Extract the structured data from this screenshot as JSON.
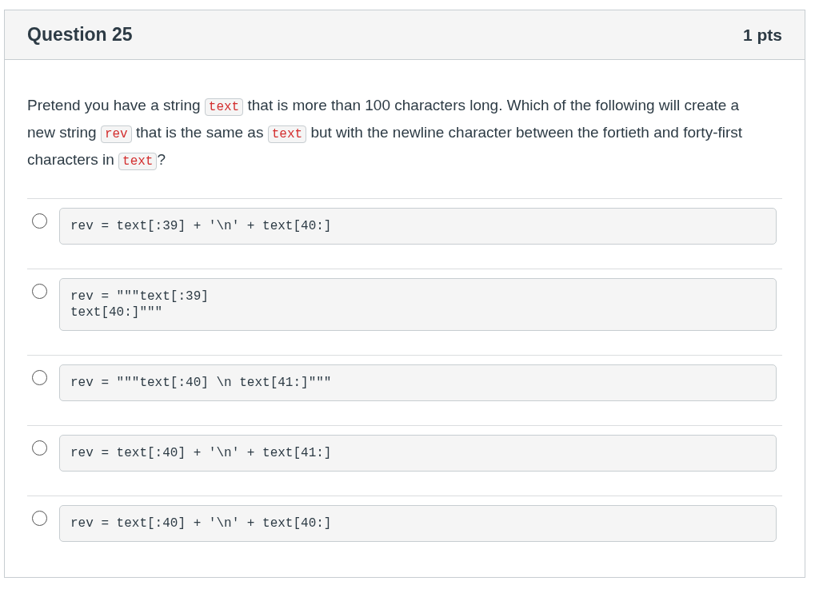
{
  "question": {
    "title": "Question 25",
    "points": "1 pts",
    "prompt": [
      {
        "kind": "text",
        "text": "Pretend you have a string "
      },
      {
        "kind": "code",
        "text": "text"
      },
      {
        "kind": "text",
        "text": " that is more than 100 characters long. Which of the following will create a new string "
      },
      {
        "kind": "code",
        "text": "rev"
      },
      {
        "kind": "text",
        "text": " that is the same as "
      },
      {
        "kind": "code",
        "text": "text"
      },
      {
        "kind": "text",
        "text": " but with the newline character between the fortieth and forty-first characters in "
      },
      {
        "kind": "code",
        "text": "text"
      },
      {
        "kind": "text",
        "text": "?"
      }
    ],
    "answers": [
      {
        "code": "rev = text[:39] + '\\n' + text[40:]",
        "selected": false
      },
      {
        "code": "rev = \"\"\"text[:39]\ntext[40:]\"\"\"",
        "selected": false
      },
      {
        "code": "rev = \"\"\"text[:40] \\n text[41:]\"\"\"",
        "selected": false
      },
      {
        "code": "rev = text[:40] + '\\n' + text[41:]",
        "selected": false
      },
      {
        "code": "rev = text[:40] + '\\n' + text[40:]",
        "selected": false
      }
    ]
  }
}
